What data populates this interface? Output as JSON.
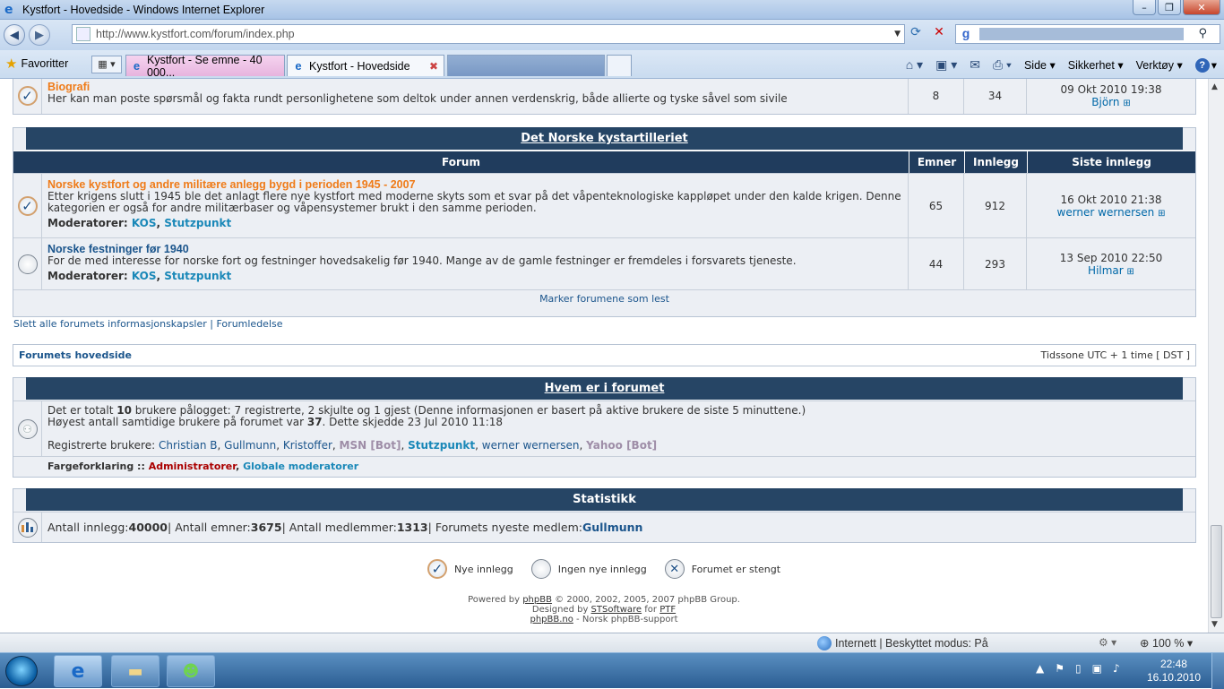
{
  "window": {
    "title": "Kystfort - Hovedside - Windows Internet Explorer"
  },
  "browser": {
    "url": "http://www.kystfort.com/forum/index.php",
    "favorites_label": "Favoritter",
    "tabs": [
      {
        "label": "Kystfort - Se emne - 40 000..."
      },
      {
        "label": "Kystfort - Hovedside"
      }
    ],
    "commands": {
      "page": "Side",
      "safety": "Sikkerhet",
      "tools": "Verktøy"
    }
  },
  "forum": {
    "prev_row": {
      "title": "Biografi",
      "desc": "Her kan man poste spørsmål og fakta rundt personlighetene som deltok under annen verdenskrig, både allierte og tyske såvel som sivile",
      "topics": "8",
      "posts": "34",
      "last_date": "09 Okt 2010 19:38",
      "last_user": "Björn"
    },
    "category": {
      "title": "Det Norske kystartilleriet",
      "headers": {
        "forum": "Forum",
        "topics": "Emner",
        "posts": "Innlegg",
        "last": "Siste innlegg"
      },
      "rows": [
        {
          "title": "Norske kystfort og andre militære anlegg bygd i perioden 1945 - 2007",
          "desc1": "Etter krigens slutt i 1945 ble det anlagt flere nye kystfort med moderne skyts som et svar på det våpenteknologiske kappløpet under den kalde krigen. Denne",
          "desc2": "kategorien er også for andre militærbaser og våpensystemer brukt i den samme perioden.",
          "mods_label": "Moderatorer:",
          "mod1": "KOS",
          "mod2": "Stutzpunkt",
          "topics": "65",
          "posts": "912",
          "last_date": "16 Okt 2010 21:38",
          "last_user": "werner wernersen"
        },
        {
          "title": "Norske festninger før 1940",
          "desc1": "For de med interesse for norske fort og festninger hovedsakelig før 1940. Mange av de gamle festninger er fremdeles i forsvarets tjeneste.",
          "mods_label": "Moderatorer:",
          "mod1": "KOS",
          "mod2": "Stutzpunkt",
          "topics": "44",
          "posts": "293",
          "last_date": "13 Sep 2010 22:50",
          "last_user": "Hilmar"
        }
      ],
      "mark_read": "Marker forumene som lest"
    },
    "links": {
      "delete_cookies": "Slett alle forumets informasjonskapsler",
      "sep": "|",
      "team": "Forumledelse"
    },
    "navstrip": {
      "home": "Forumets hovedside",
      "timezone": "Tidssone UTC + 1 time [ DST ]"
    },
    "who": {
      "title": "Hvem er i forumet",
      "line1_pre": "Det er totalt ",
      "line1_num": "10",
      "line1_post": " brukere pålogget: 7 registrerte, 2 skjulte og 1 gjest (Denne informasjonen er basert på aktive brukere de siste 5 minuttene.)",
      "line2_pre": "Høyest antall samtidige brukere på forumet var ",
      "line2_num": "37",
      "line2_post": ". Dette skjedde 23 Jul 2010 11:18",
      "reg_label": "Registrerte brukere: ",
      "users": [
        "Christian B",
        "Gullmunn",
        "Kristoffer",
        "MSN [Bot]",
        "Stutzpunkt",
        "werner wernersen",
        "Yahoo [Bot]"
      ],
      "legend_label": "Fargeforklaring :: ",
      "legend_admin": "Administratorer",
      "legend_global": "Globale moderatorer"
    },
    "stats": {
      "title": "Statistikk",
      "posts_label": "Antall innlegg: ",
      "posts": "40000",
      "topics_label": " | Antall emner: ",
      "topics": "3675",
      "members_label": " | Antall medlemmer: ",
      "members": "1313",
      "newest_label": " | Forumets nyeste medlem: ",
      "newest": "Gullmunn"
    },
    "icon_legend": {
      "new": "Nye innlegg",
      "none": "Ingen nye innlegg",
      "locked": "Forumet er stengt"
    },
    "credits": {
      "l1_pre": "Powered by ",
      "l1_link": "phpBB",
      "l1_post": " © 2000, 2002, 2005, 2007 phpBB Group.",
      "l2_pre": "Designed by ",
      "l2_link": "STSoftware",
      "l2_mid": " for ",
      "l2_link2": "PTF",
      "l3_link": "phpBB.no",
      "l3_post": " - Norsk phpBB-support"
    }
  },
  "status": {
    "zone": "Internett | Beskyttet modus: På",
    "zoom": "100 %"
  },
  "taskbar": {
    "time": "22:48",
    "date": "16.10.2010"
  }
}
